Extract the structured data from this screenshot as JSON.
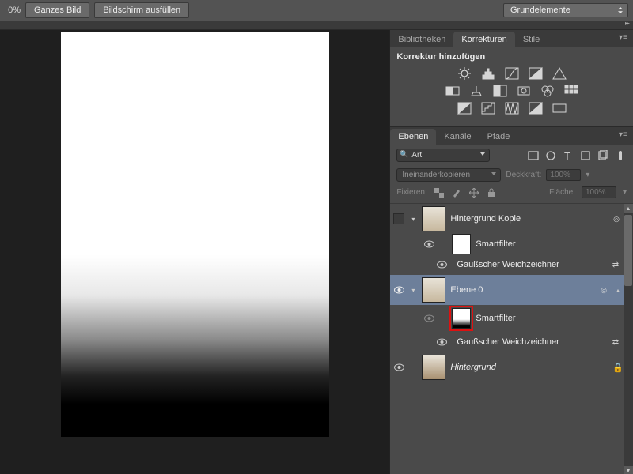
{
  "topbar": {
    "zoom_label": "0%",
    "fit_image_label": "Ganzes Bild",
    "fill_screen_label": "Bildschirm ausfüllen",
    "workspace_selected": "Grundelemente"
  },
  "adjustments_panel": {
    "tabs": {
      "bibliotheken": "Bibliotheken",
      "korrekturen": "Korrekturen",
      "stile": "Stile"
    },
    "title": "Korrektur hinzufügen"
  },
  "layers_panel": {
    "tabs": {
      "ebenen": "Ebenen",
      "kanaele": "Kanäle",
      "pfade": "Pfade"
    },
    "filter_kind": "Art",
    "blend_mode": "Ineinanderkopieren",
    "opacity_label": "Deckkraft:",
    "opacity_value": "100%",
    "lock_label": "Fixieren:",
    "fill_label": "Fläche:",
    "fill_value": "100%",
    "layers": [
      {
        "name": "Hintergrund Kopie",
        "smart_label": "Smartfilter",
        "filter_name": "Gaußscher Weichzeichner"
      },
      {
        "name": "Ebene 0",
        "smart_label": "Smartfilter",
        "filter_name": "Gaußscher Weichzeichner"
      },
      {
        "name": "Hintergrund"
      }
    ]
  }
}
